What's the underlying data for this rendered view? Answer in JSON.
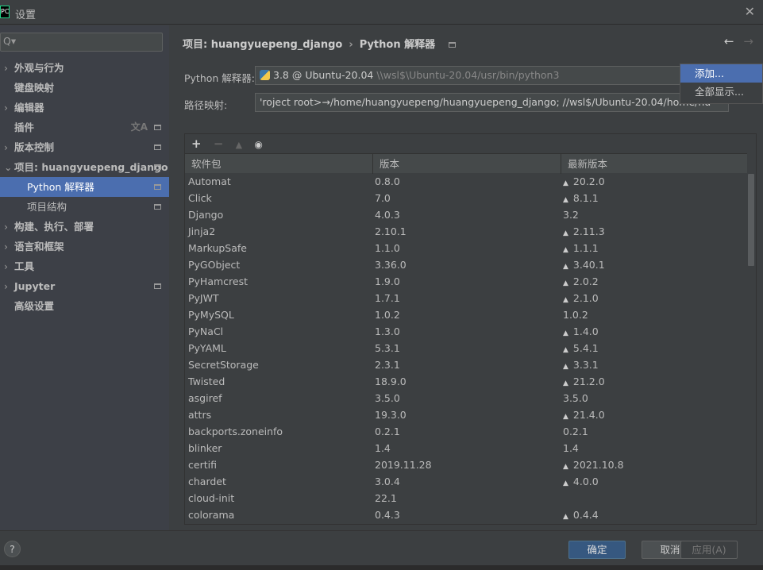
{
  "window": {
    "title": "设置",
    "logo": "PC"
  },
  "sidebar": {
    "search_placeholder": "Q▾",
    "items": [
      {
        "label": "外观与行为",
        "arrow": true
      },
      {
        "label": "键盘映射"
      },
      {
        "label": "编辑器",
        "arrow": true
      },
      {
        "label": "插件",
        "translate": true,
        "mini": true
      },
      {
        "label": "版本控制",
        "arrow": true,
        "mini": true
      },
      {
        "label": "项目: huangyuepeng_django",
        "arrow": true,
        "mini": true,
        "expanded": true
      },
      {
        "label": "Python 解释器",
        "sub": true,
        "selected": true,
        "mini": true
      },
      {
        "label": "项目结构",
        "sub": true,
        "mini": true
      },
      {
        "label": "构建、执行、部署",
        "arrow": true
      },
      {
        "label": "语言和框架",
        "arrow": true
      },
      {
        "label": "工具",
        "arrow": true
      },
      {
        "label": "Jupyter",
        "arrow": true,
        "mini": true
      },
      {
        "label": "高级设置"
      }
    ]
  },
  "breadcrumb": {
    "project": "项目: huangyuepeng_django",
    "sep": "›",
    "page": "Python 解释器"
  },
  "interpreter": {
    "label": "Python 解释器:",
    "version": "3.8 @ Ubuntu-20.04",
    "path": "\\\\wsl$\\Ubuntu-20.04/usr/bin/python3"
  },
  "path_mapping": {
    "label": "路径映射:",
    "value": "'roject root>→/home/huangyuepeng/huangyuepeng_django; //wsl$/Ubuntu-20.04/home/hu"
  },
  "popup": {
    "items": [
      "添加...",
      "全部显示..."
    ]
  },
  "toolbar": {
    "add": "+",
    "remove": "−",
    "upgrade": "▲",
    "show": "◉"
  },
  "table": {
    "headers": [
      "软件包",
      "版本",
      "最新版本"
    ],
    "rows": [
      [
        "Automat",
        "0.8.0",
        "20.2.0",
        true
      ],
      [
        "Click",
        "7.0",
        "8.1.1",
        true
      ],
      [
        "Django",
        "4.0.3",
        "3.2",
        false
      ],
      [
        "Jinja2",
        "2.10.1",
        "2.11.3",
        true
      ],
      [
        "MarkupSafe",
        "1.1.0",
        "1.1.1",
        true
      ],
      [
        "PyGObject",
        "3.36.0",
        "3.40.1",
        true
      ],
      [
        "PyHamcrest",
        "1.9.0",
        "2.0.2",
        true
      ],
      [
        "PyJWT",
        "1.7.1",
        "2.1.0",
        true
      ],
      [
        "PyMySQL",
        "1.0.2",
        "1.0.2",
        false
      ],
      [
        "PyNaCl",
        "1.3.0",
        "1.4.0",
        true
      ],
      [
        "PyYAML",
        "5.3.1",
        "5.4.1",
        true
      ],
      [
        "SecretStorage",
        "2.3.1",
        "3.3.1",
        true
      ],
      [
        "Twisted",
        "18.9.0",
        "21.2.0",
        true
      ],
      [
        "asgiref",
        "3.5.0",
        "3.5.0",
        false
      ],
      [
        "attrs",
        "19.3.0",
        "21.4.0",
        true
      ],
      [
        "backports.zoneinfo",
        "0.2.1",
        "0.2.1",
        false
      ],
      [
        "blinker",
        "1.4",
        "1.4",
        false
      ],
      [
        "certifi",
        "2019.11.28",
        "2021.10.8",
        true
      ],
      [
        "chardet",
        "3.0.4",
        "4.0.0",
        true
      ],
      [
        "cloud-init",
        "22.1",
        "",
        false
      ],
      [
        "colorama",
        "0.4.3",
        "0.4.4",
        true
      ]
    ]
  },
  "footer": {
    "help": "?",
    "ok": "确定",
    "cancel": "取消",
    "apply": "应用(A)"
  }
}
